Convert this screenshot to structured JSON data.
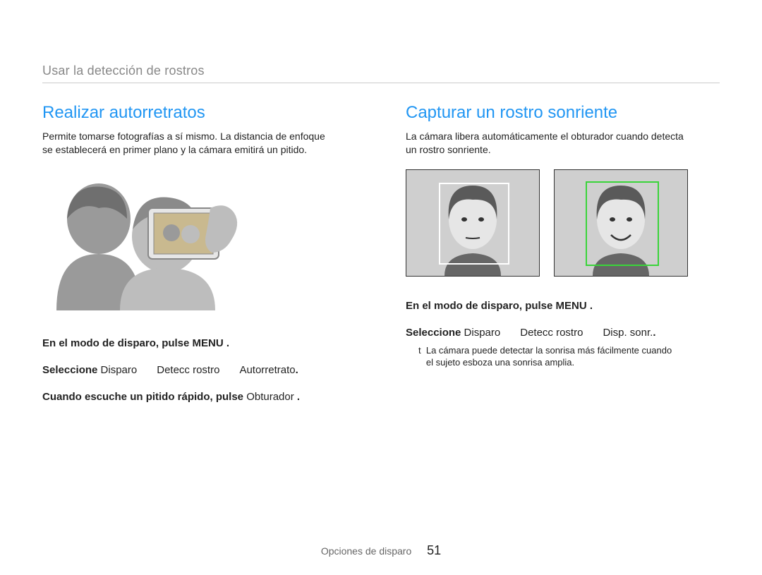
{
  "breadcrumb": "Usar la detección de rostros",
  "left": {
    "title": "Realizar autorretratos",
    "body1": "Permite tomarse fotografías a sí mismo. La distancia de enfoque",
    "body2": "se establecerá en primer plano y la cámara emitirá un pitido.",
    "step1_pre": "En el modo de disparo, pulse ",
    "step1_btn": "MENU",
    "step1_post": " .",
    "step2_pre": "Seleccione ",
    "step2_a": "Disparo",
    "step2_b": "Detecc rostro",
    "step2_c": "Autorretrato",
    "step2_post": ".",
    "step3_pre": "Cuando escuche un pitido rápido, pulse ",
    "step3_btn": "Obturador",
    "step3_post": " ."
  },
  "right": {
    "title": "Capturar un rostro sonriente",
    "body1": "La cámara libera automáticamente el obturador cuando detecta",
    "body2": "un rostro sonriente.",
    "step1_pre": "En el modo de disparo, pulse ",
    "step1_btn": "MENU",
    "step1_post": " .",
    "step2_pre": "Seleccione ",
    "step2_a": "Disparo",
    "step2_b": "Detecc rostro",
    "step2_c": "Disp. sonr.",
    "step2_post": ".",
    "note_bullet": "t",
    "note1": "La cámara puede detectar la sonrisa más fácilmente cuando",
    "note2": "el sujeto esboza una sonrisa amplia."
  },
  "footer": {
    "section": "Opciones de disparo",
    "page": "51"
  },
  "icons": {
    "menu": "MENU"
  }
}
